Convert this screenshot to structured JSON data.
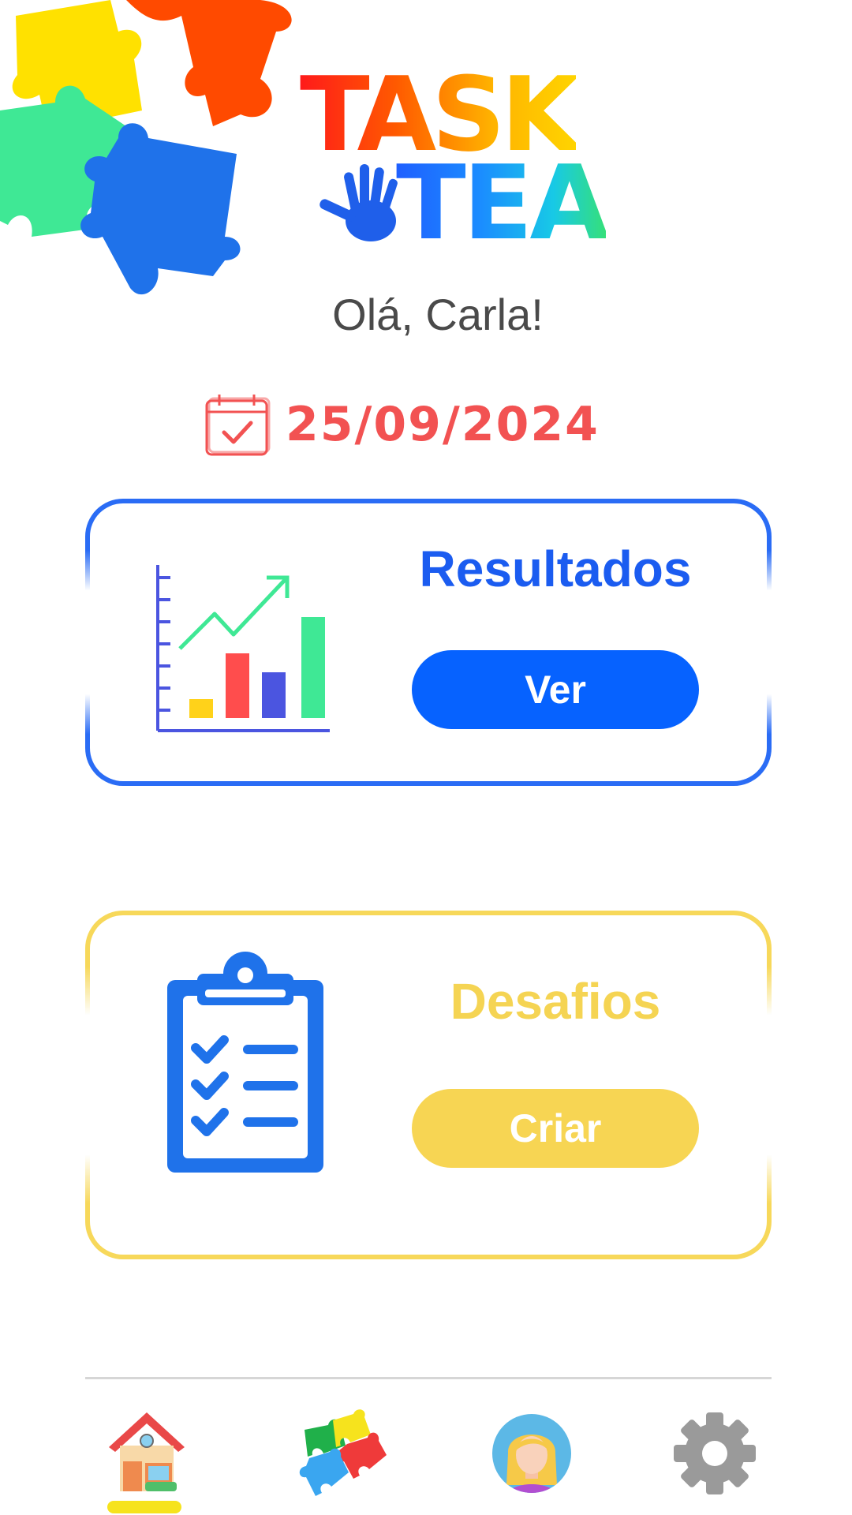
{
  "app": {
    "logo_text_top": "TASK",
    "logo_text_bottom": "TEA"
  },
  "greeting": "Olá, Carla!",
  "date": {
    "icon": "calendar-check-icon",
    "value": "25/09/2024"
  },
  "cards": {
    "resultados": {
      "title": "Resultados",
      "button_label": "Ver",
      "icon": "bar-chart-growth-icon",
      "accent": "#1b5cf0",
      "button_color": "#0662ff"
    },
    "desafios": {
      "title": "Desafios",
      "button_label": "Criar",
      "icon": "clipboard-checklist-icon",
      "accent": "#f5d453",
      "button_color": "#f7d553"
    }
  },
  "bottom_nav": {
    "items": [
      {
        "id": "home",
        "icon": "home-icon",
        "active": true
      },
      {
        "id": "puzzles",
        "icon": "puzzle-icon",
        "active": false
      },
      {
        "id": "profile",
        "icon": "avatar-icon",
        "active": false
      },
      {
        "id": "settings",
        "icon": "gear-icon",
        "active": false
      }
    ],
    "active_indicator_color": "#f6e31d"
  }
}
